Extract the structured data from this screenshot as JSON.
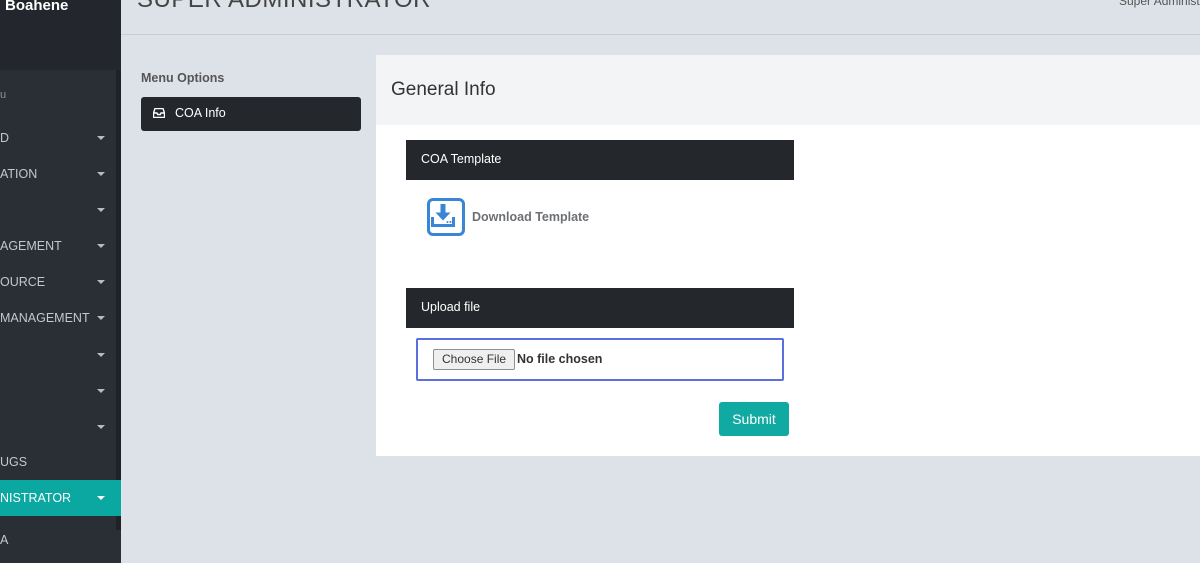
{
  "sidebar": {
    "user_name": "Boahene",
    "menu_header": "u",
    "items": [
      {
        "label": "D"
      },
      {
        "label": "ATION"
      },
      {
        "label": ""
      },
      {
        "label": "AGEMENT"
      },
      {
        "label": "OURCE"
      },
      {
        "label": "MANAGEMENT"
      },
      {
        "label": ""
      },
      {
        "label": ""
      },
      {
        "label": ""
      },
      {
        "label": "UGS"
      },
      {
        "label": "NISTRATOR"
      },
      {
        "label": "A"
      }
    ]
  },
  "header": {
    "title": "SUPER ADMINISTRATOR",
    "user_role": "Super Administrator"
  },
  "menu_options": {
    "title": "Menu Options",
    "items": [
      {
        "label": "COA Info"
      }
    ]
  },
  "panel": {
    "title": "General Info",
    "coa_template": {
      "heading": "COA Template",
      "download_label": "Download Template"
    },
    "upload": {
      "heading": "Upload file",
      "choose_label": "Choose File",
      "status": "No file chosen",
      "submit_label": "Submit"
    }
  },
  "colors": {
    "accent": "#10aaa2",
    "dark": "#24272b",
    "page_bg": "#dde2e9",
    "focus_border": "#5a6fe0",
    "icon_blue": "#3a86d6"
  }
}
